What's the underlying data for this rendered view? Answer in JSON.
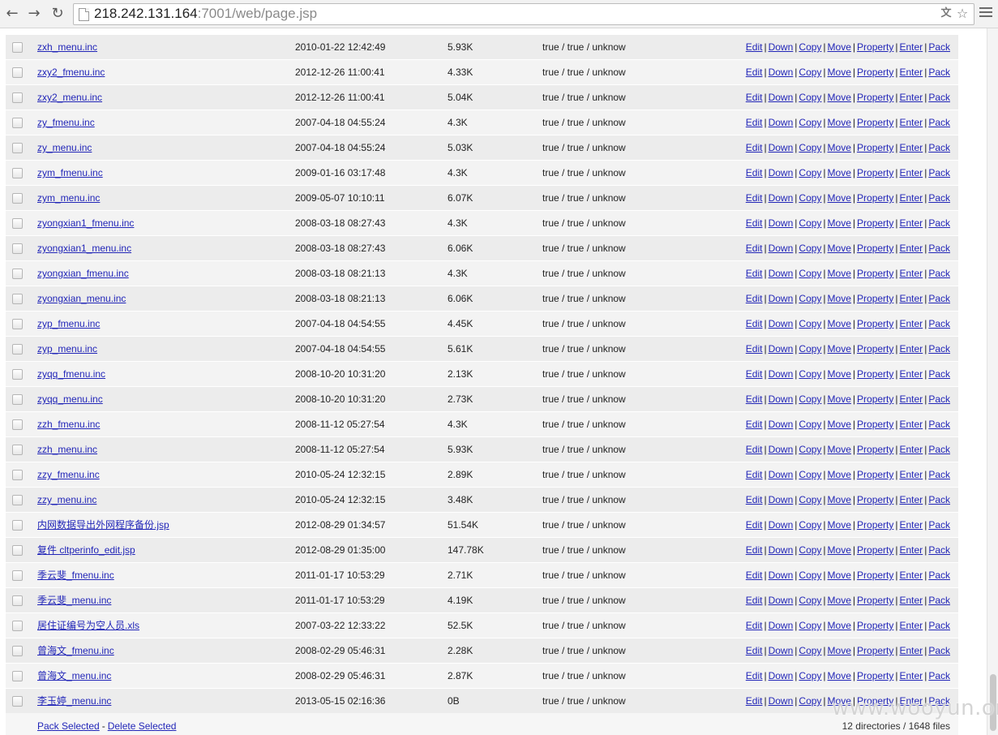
{
  "browser": {
    "url_host": "218.242.131.164",
    "url_rest": ":7001/web/page.jsp",
    "back_icon": "back-arrow-icon",
    "forward_icon": "forward-arrow-icon",
    "reload_icon": "reload-icon",
    "translate_icon": "translate-icon",
    "bookmark_icon": "star-icon",
    "menu_icon": "hamburger-menu-icon"
  },
  "actions": {
    "edit": "Edit",
    "down": "Down",
    "copy": "Copy",
    "move": "Move",
    "property": "Property",
    "enter": "Enter",
    "pack": "Pack",
    "separator": "|"
  },
  "files": [
    {
      "name": "zxh_menu.inc",
      "time": "2010-01-22 12:42:49",
      "size": "5.93K",
      "perm": "true / true / unknow"
    },
    {
      "name": "zxy2_fmenu.inc",
      "time": "2012-12-26 11:00:41",
      "size": "4.33K",
      "perm": "true / true / unknow"
    },
    {
      "name": "zxy2_menu.inc",
      "time": "2012-12-26 11:00:41",
      "size": "5.04K",
      "perm": "true / true / unknow"
    },
    {
      "name": "zy_fmenu.inc",
      "time": "2007-04-18 04:55:24",
      "size": "4.3K",
      "perm": "true / true / unknow"
    },
    {
      "name": "zy_menu.inc",
      "time": "2007-04-18 04:55:24",
      "size": "5.03K",
      "perm": "true / true / unknow"
    },
    {
      "name": "zym_fmenu.inc",
      "time": "2009-01-16 03:17:48",
      "size": "4.3K",
      "perm": "true / true / unknow"
    },
    {
      "name": "zym_menu.inc",
      "time": "2009-05-07 10:10:11",
      "size": "6.07K",
      "perm": "true / true / unknow"
    },
    {
      "name": "zyongxian1_fmenu.inc",
      "time": "2008-03-18 08:27:43",
      "size": "4.3K",
      "perm": "true / true / unknow"
    },
    {
      "name": "zyongxian1_menu.inc",
      "time": "2008-03-18 08:27:43",
      "size": "6.06K",
      "perm": "true / true / unknow"
    },
    {
      "name": "zyongxian_fmenu.inc",
      "time": "2008-03-18 08:21:13",
      "size": "4.3K",
      "perm": "true / true / unknow"
    },
    {
      "name": "zyongxian_menu.inc",
      "time": "2008-03-18 08:21:13",
      "size": "6.06K",
      "perm": "true / true / unknow"
    },
    {
      "name": "zyp_fmenu.inc",
      "time": "2007-04-18 04:54:55",
      "size": "4.45K",
      "perm": "true / true / unknow"
    },
    {
      "name": "zyp_menu.inc",
      "time": "2007-04-18 04:54:55",
      "size": "5.61K",
      "perm": "true / true / unknow"
    },
    {
      "name": "zyqq_fmenu.inc",
      "time": "2008-10-20 10:31:20",
      "size": "2.13K",
      "perm": "true / true / unknow"
    },
    {
      "name": "zyqq_menu.inc",
      "time": "2008-10-20 10:31:20",
      "size": "2.73K",
      "perm": "true / true / unknow"
    },
    {
      "name": "zzh_fmenu.inc",
      "time": "2008-11-12 05:27:54",
      "size": "4.3K",
      "perm": "true / true / unknow"
    },
    {
      "name": "zzh_menu.inc",
      "time": "2008-11-12 05:27:54",
      "size": "5.93K",
      "perm": "true / true / unknow"
    },
    {
      "name": "zzy_fmenu.inc",
      "time": "2010-05-24 12:32:15",
      "size": "2.89K",
      "perm": "true / true / unknow"
    },
    {
      "name": "zzy_menu.inc",
      "time": "2010-05-24 12:32:15",
      "size": "3.48K",
      "perm": "true / true / unknow"
    },
    {
      "name": "内网数据导出外网程序备份.jsp",
      "time": "2012-08-29 01:34:57",
      "size": "51.54K",
      "perm": "true / true / unknow"
    },
    {
      "name": "复件 cltperinfo_edit.jsp",
      "time": "2012-08-29 01:35:00",
      "size": "147.78K",
      "perm": "true / true / unknow"
    },
    {
      "name": "季云斐_fmenu.inc",
      "time": "2011-01-17 10:53:29",
      "size": "2.71K",
      "perm": "true / true / unknow"
    },
    {
      "name": "季云斐_menu.inc",
      "time": "2011-01-17 10:53:29",
      "size": "4.19K",
      "perm": "true / true / unknow"
    },
    {
      "name": "居住证编号为空人员.xls",
      "time": "2007-03-22 12:33:22",
      "size": "52.5K",
      "perm": "true / true / unknow"
    },
    {
      "name": "曾海文_fmenu.inc",
      "time": "2008-02-29 05:46:31",
      "size": "2.28K",
      "perm": "true / true / unknow"
    },
    {
      "name": "曾海文_menu.inc",
      "time": "2008-02-29 05:46:31",
      "size": "2.87K",
      "perm": "true / true / unknow"
    },
    {
      "name": "李玉婷_menu.inc",
      "time": "2013-05-15 02:16:36",
      "size": "0B",
      "perm": "true / true / unknow"
    }
  ],
  "footer": {
    "pack_selected": "Pack Selected",
    "dash": "-",
    "delete_selected": "Delete Selected",
    "summary": "12 directories / 1648 files"
  },
  "watermark": "www.wooyun.org"
}
